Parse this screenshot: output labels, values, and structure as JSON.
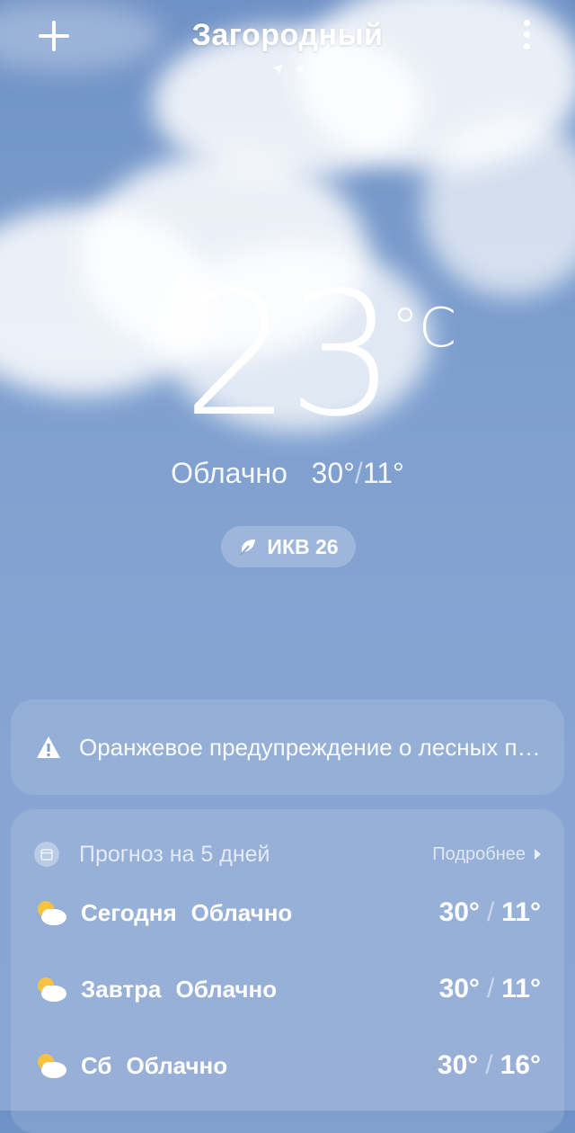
{
  "header": {
    "city": "Загородный",
    "add_icon": "plus-icon",
    "more_icon": "more-vertical-icon"
  },
  "current": {
    "temperature": "23",
    "unit": "°C",
    "condition": "Облачно",
    "high": "30°",
    "low": "11°",
    "aqi_label": "ИКВ 26"
  },
  "alert": {
    "text": "Оранжевое предупреждение о лесных пожарах"
  },
  "forecast": {
    "title": "Прогноз на 5 дней",
    "more_label": "Подробнее",
    "days": [
      {
        "day": "Сегодня",
        "condition": "Облачно",
        "high": "30°",
        "low": "11°",
        "icon": "partly-cloudy-icon"
      },
      {
        "day": "Завтра",
        "condition": "Облачно",
        "high": "30°",
        "low": "11°",
        "icon": "partly-cloudy-icon"
      },
      {
        "day": "Сб",
        "condition": "Облачно",
        "high": "30°",
        "low": "16°",
        "icon": "partly-cloudy-icon"
      }
    ]
  },
  "colors": {
    "background_top": "#6f92c6",
    "background_bottom": "#8aa6d2",
    "sun": "#f5c242"
  }
}
